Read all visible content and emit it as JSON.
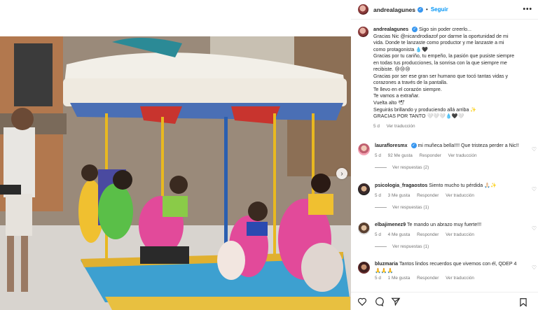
{
  "post": {
    "username": "andrealagunes",
    "follow_label": "Seguir",
    "more_label": "•••",
    "separator": "•",
    "caption_lines": [
      "Sigo sin poder creerlo...",
      "Gracias Nic @nicandrodiazof por darme la oportunidad de mi",
      "vida. Donde te lanzaste como productor y me lanzaste a mi",
      "como protagonista 💧🖤",
      "Gracias por tu cariño, tu empeño, la pasión que pusiste siempre",
      "en todas tus producciones, la sonrisa con la que siempre me",
      "recibiste. 😢😢😢",
      "Gracias por ser ese gran ser humano que tocó tantas vidas y",
      "corazones a través de la pantalla.",
      "Te llevo en el corazón siempre.",
      "Te vamos a extrañar.",
      "Vuelta alto 🕊",
      "Seguirás brillando y produciendo allá arriba ✨",
      "GRACIAS POR TANTO 🤍🤍🤍💧🖤🤍"
    ],
    "time": "5 d",
    "see_translation": "Ver traducción"
  },
  "comments": [
    {
      "username": "laurafloresmx",
      "text": "mi muñeca bella!!!! Que tristeza perder a Nic!!",
      "time": "5 d",
      "likes": "92 Me gusta",
      "reply": "Responder",
      "translate": "Ver traducción",
      "replies": "Ver respuestas (2)"
    },
    {
      "username": "psicologia_fragaostos",
      "text": "Siento mucho tu pérdida 🙏🏻✨",
      "time": "5 d",
      "likes": "3 Me gusta",
      "reply": "Responder",
      "translate": "Ver traducción",
      "replies": "Ver respuestas (1)"
    },
    {
      "username": "elbajimenez9",
      "text": "Te mando un abrazo muy fuerte!!!",
      "time": "5 d",
      "likes": "4 Me gusta",
      "reply": "Responder",
      "translate": "Ver traducción",
      "replies": "Ver respuestas (1)"
    },
    {
      "username": "bluzmaria",
      "text": "Tantos lindos recuerdos que vivemos con él, QDEP 4",
      "text2": "🙏🙏🙏",
      "time": "5 d",
      "likes": "1 Me gusta",
      "reply": "Responder",
      "translate": "Ver traducción"
    }
  ],
  "icons": {
    "heart": "heart-icon",
    "comment": "comment-icon",
    "share": "share-icon",
    "save": "bookmark-icon",
    "next": "chevron-right-icon"
  },
  "colors": {
    "accent": "#0095f6",
    "verified": "#3897f0",
    "muted": "#737373"
  }
}
